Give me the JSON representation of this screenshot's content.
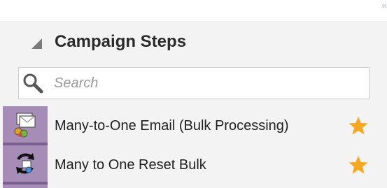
{
  "panel": {
    "title": "Campaign Steps",
    "collapse_icon": "«"
  },
  "search": {
    "placeholder": "Search",
    "value": "",
    "icon": "search-icon"
  },
  "items": [
    {
      "label": "Many-to-One Email (Bulk Processing)",
      "icon": "bulk-email-icon",
      "favorite": true
    },
    {
      "label": "Many to One Reset Bulk",
      "icon": "reset-bulk-icon",
      "favorite": true
    }
  ],
  "colors": {
    "icon_bg": "#a58db8",
    "star": "#f5a623",
    "panel_bg": "#f3f3f3"
  }
}
